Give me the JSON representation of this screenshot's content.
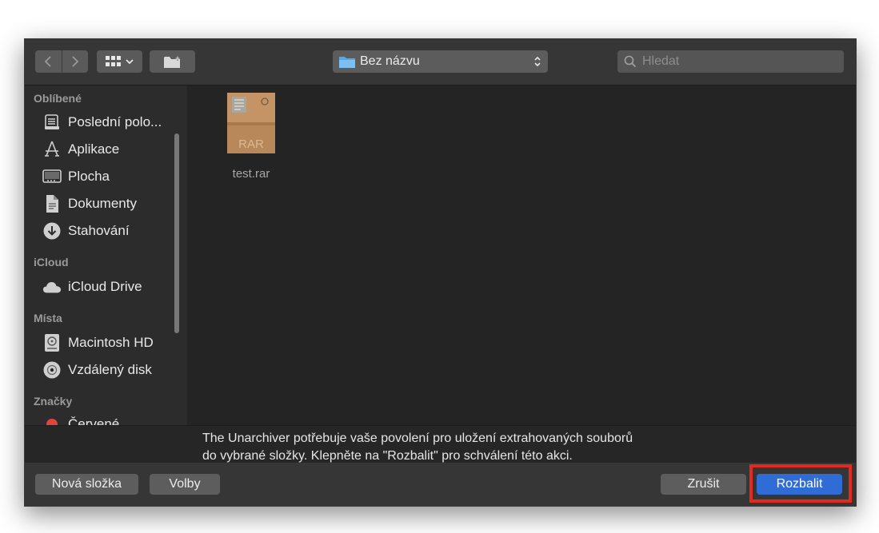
{
  "toolbar": {
    "path_label": "Bez názvu",
    "search_placeholder": "Hledat"
  },
  "sidebar": {
    "sections": [
      {
        "title": "Oblíbené",
        "items": [
          {
            "label": "Poslední polo...",
            "icon": "clock-stack-icon"
          },
          {
            "label": "Aplikace",
            "icon": "applications-icon"
          },
          {
            "label": "Plocha",
            "icon": "desktop-icon"
          },
          {
            "label": "Dokumenty",
            "icon": "document-icon"
          },
          {
            "label": "Stahování",
            "icon": "download-icon"
          }
        ]
      },
      {
        "title": "iCloud",
        "items": [
          {
            "label": "iCloud Drive",
            "icon": "cloud-icon"
          }
        ]
      },
      {
        "title": "Místa",
        "items": [
          {
            "label": "Macintosh HD",
            "icon": "hard-drive-icon"
          },
          {
            "label": "Vzdálený disk",
            "icon": "disc-icon"
          }
        ]
      },
      {
        "title": "Značky",
        "items": [
          {
            "label": "Červené",
            "icon": "red-tag-icon"
          }
        ]
      }
    ]
  },
  "files": [
    {
      "name": "test.rar",
      "badge": "RAR"
    }
  ],
  "info": {
    "line1": "The Unarchiver potřebuje vaše povolení pro uložení extrahovaných souborů",
    "line2": "do vybrané složky. Klepněte na \"Rozbalit\" pro schválení této akci."
  },
  "buttons": {
    "new_folder": "Nová složka",
    "options": "Volby",
    "cancel": "Zrušit",
    "extract": "Rozbalit"
  },
  "colors": {
    "accent": "#2f6cd6",
    "highlight": "#e5291d",
    "tag_red": "#e0443c"
  }
}
